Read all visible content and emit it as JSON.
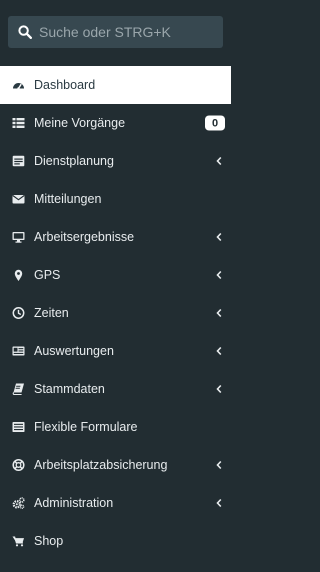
{
  "colors": {
    "sidebar_bg": "#222d32",
    "search_bg": "#374850",
    "active_bg": "#ffffff",
    "text": "#e8ecee",
    "active_text": "#2a3a42"
  },
  "search": {
    "placeholder": "Suche oder STRG+K",
    "value": ""
  },
  "menu": {
    "items": [
      {
        "label": "Dashboard",
        "icon": "dashboard-icon",
        "active": true
      },
      {
        "label": "Meine Vorgänge",
        "icon": "list-icon",
        "badge": "0"
      },
      {
        "label": "Dienstplanung",
        "icon": "calendar-list-icon",
        "submenu": true
      },
      {
        "label": "Mitteilungen",
        "icon": "envelope-icon"
      },
      {
        "label": "Arbeitsergebnisse",
        "icon": "monitor-icon",
        "submenu": true
      },
      {
        "label": "GPS",
        "icon": "map-marker-icon",
        "submenu": true
      },
      {
        "label": "Zeiten",
        "icon": "clock-icon",
        "submenu": true
      },
      {
        "label": "Auswertungen",
        "icon": "id-card-icon",
        "submenu": true
      },
      {
        "label": "Stammdaten",
        "icon": "book-icon",
        "submenu": true
      },
      {
        "label": "Flexible Formulare",
        "icon": "form-icon"
      },
      {
        "label": "Arbeitsplatzabsicherung",
        "icon": "life-ring-icon",
        "submenu": true
      },
      {
        "label": "Administration",
        "icon": "cogs-icon",
        "submenu": true
      },
      {
        "label": "Shop",
        "icon": "shopping-cart-icon"
      }
    ]
  }
}
